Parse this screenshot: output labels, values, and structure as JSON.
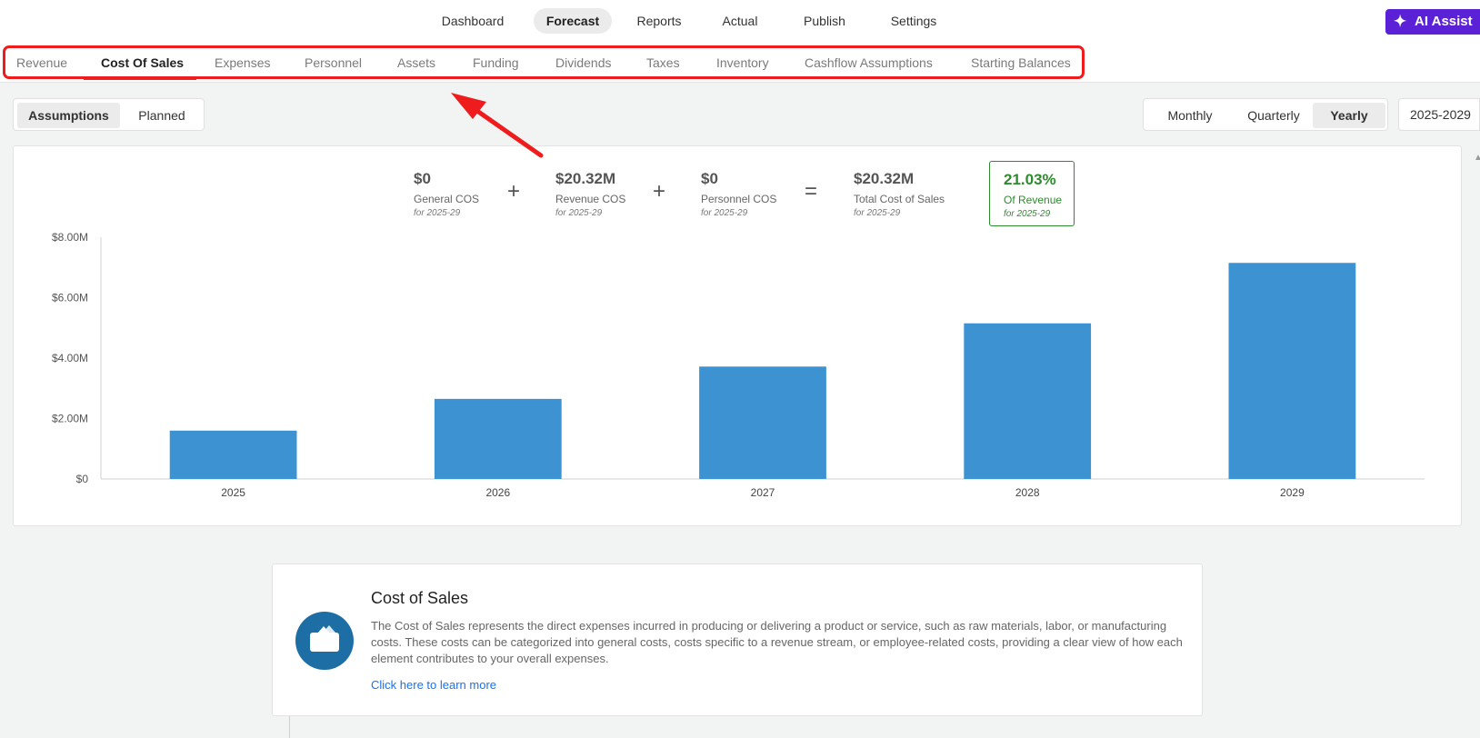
{
  "topnav": {
    "items": [
      "Dashboard",
      "Forecast",
      "Reports",
      "Actual",
      "Publish",
      "Settings"
    ],
    "active": "Forecast",
    "ai_assist": "AI Assist"
  },
  "subtabs": {
    "items": [
      "Revenue",
      "Cost Of Sales",
      "Expenses",
      "Personnel",
      "Assets",
      "Funding",
      "Dividends",
      "Taxes",
      "Inventory",
      "Cashflow Assumptions",
      "Starting Balances"
    ],
    "active": "Cost Of Sales"
  },
  "view_toggle": {
    "items": [
      "Assumptions",
      "Planned"
    ],
    "active": "Assumptions"
  },
  "period_toggle": {
    "items": [
      "Monthly",
      "Quarterly",
      "Yearly"
    ],
    "active": "Yearly"
  },
  "date_range": "2025-2029",
  "summary": {
    "general": {
      "value": "$0",
      "label": "General COS",
      "period": "for 2025-29"
    },
    "revenue": {
      "value": "$20.32M",
      "label": "Revenue COS",
      "period": "for 2025-29"
    },
    "personnel": {
      "value": "$0",
      "label": "Personnel COS",
      "period": "for 2025-29"
    },
    "total": {
      "value": "$20.32M",
      "label": "Total Cost of Sales",
      "period": "for 2025-29"
    },
    "of_revenue": {
      "value": "21.03%",
      "label": "Of Revenue",
      "period": "for 2025-29"
    },
    "plus": "+",
    "equals": "="
  },
  "chart_data": {
    "type": "bar",
    "categories": [
      "2025",
      "2026",
      "2027",
      "2028",
      "2029"
    ],
    "values": [
      1.6,
      2.65,
      3.72,
      5.15,
      7.15
    ],
    "ylim": [
      0,
      8
    ],
    "yticks": [
      "$0",
      "$2.00M",
      "$4.00M",
      "$6.00M",
      "$8.00M"
    ],
    "color": "#3d93d1",
    "grid": false
  },
  "info": {
    "title": "Cost of Sales",
    "description": "The Cost of Sales represents the direct expenses incurred in producing or delivering a product or service, such as raw materials, labor, or manufacturing costs. These costs can be categorized into general costs, costs specific to a revenue stream, or employee-related costs, providing a clear view of how each element contributes to your overall expenses.",
    "link": "Click here to learn more",
    "icon": "wallet-icon"
  },
  "annotation": {
    "color": "#ee1c1c"
  }
}
